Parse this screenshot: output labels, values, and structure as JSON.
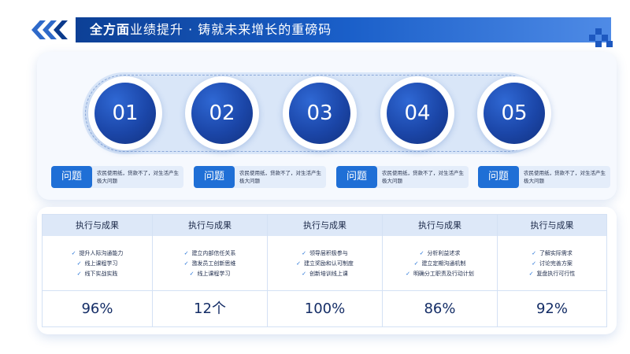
{
  "header": {
    "title_bold": "全方面",
    "title_rest": "业绩提升 · 铸就未来增长的重磅码"
  },
  "steps": [
    "01",
    "02",
    "03",
    "04",
    "05"
  ],
  "issues": [
    {
      "tag": "问题",
      "desc": "农民使用纸，贷款不了，对生活产生极大问题"
    },
    {
      "tag": "问题",
      "desc": "农民使用纸，贷款不了，对生活产生极大问题"
    },
    {
      "tag": "问题",
      "desc": "农民使用纸，贷款不了，对生活产生极大问题"
    },
    {
      "tag": "问题",
      "desc": "农民使用纸，贷款不了，对生活产生极大问题"
    }
  ],
  "table": {
    "columns": [
      {
        "header": "执行与成果",
        "items": [
          "提升人际沟通能力",
          "线上课程学习",
          "线下实战实践"
        ],
        "value": "96%"
      },
      {
        "header": "执行与成果",
        "items": [
          "建立内部信任关系",
          "激发员工创新思维",
          "线上课程学习"
        ],
        "value": "12个"
      },
      {
        "header": "执行与成果",
        "items": [
          "领导层积极参与",
          "建立奖励和认可制度",
          "创新培训线上课"
        ],
        "value": "100%"
      },
      {
        "header": "执行与成果",
        "items": [
          "分析利益述求",
          "建立定期沟通机制",
          "明确分工职责及行动计划"
        ],
        "value": "86%"
      },
      {
        "header": "执行与成果",
        "items": [
          "了解实际需求",
          "讨论完善方案",
          "复盘执行可行性"
        ],
        "value": "92%"
      }
    ],
    "check_icon": "✓"
  },
  "colors": {
    "primary": "#1a5fc9",
    "dark": "#12317e",
    "tag": "#1f6fd6"
  }
}
